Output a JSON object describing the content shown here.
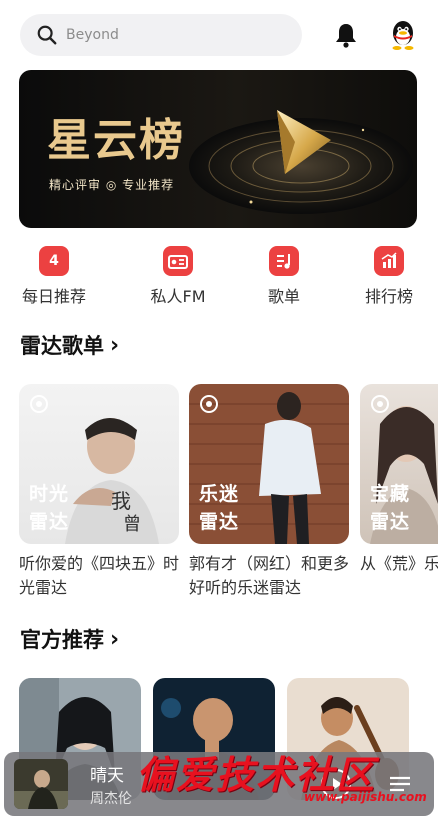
{
  "search": {
    "placeholder": "Beyond",
    "icon": "search-icon"
  },
  "header": {
    "bell_icon": "bell-icon",
    "avatar_icon": "qq-penguin-icon"
  },
  "banner": {
    "title": "星云榜",
    "subtitle": "精心评审 ◎ 专业推荐"
  },
  "quick_menu": [
    {
      "label": "每日推荐",
      "icon": "calendar-icon",
      "glyph": "4"
    },
    {
      "label": "私人FM",
      "icon": "radio-icon"
    },
    {
      "label": "歌单",
      "icon": "playlist-icon"
    },
    {
      "label": "排行榜",
      "icon": "chart-icon"
    }
  ],
  "radar": {
    "title": "雷达歌单",
    "chevron": "›",
    "items": [
      {
        "cover_line1": "时光",
        "cover_line2": "雷达",
        "caption": "听你爱的《四块五》时光雷达"
      },
      {
        "cover_line1": "乐迷",
        "cover_line2": "雷达",
        "caption": "郭有才（网红）和更多好听的乐迷雷达"
      },
      {
        "cover_line1": "宝藏",
        "cover_line2": "雷达",
        "caption": "从《荒》乐环游"
      }
    ]
  },
  "official": {
    "title": "官方推荐",
    "chevron": "›"
  },
  "player": {
    "song": "晴天",
    "artist": "周杰伦",
    "play_icon": "play-icon",
    "list_icon": "playlist-queue-icon"
  },
  "watermark": {
    "text": "偏爱技术社区",
    "url": "www.paijishu.com"
  },
  "colors": {
    "accent": "#ec4141",
    "banner_gold": "#e9c98e"
  }
}
